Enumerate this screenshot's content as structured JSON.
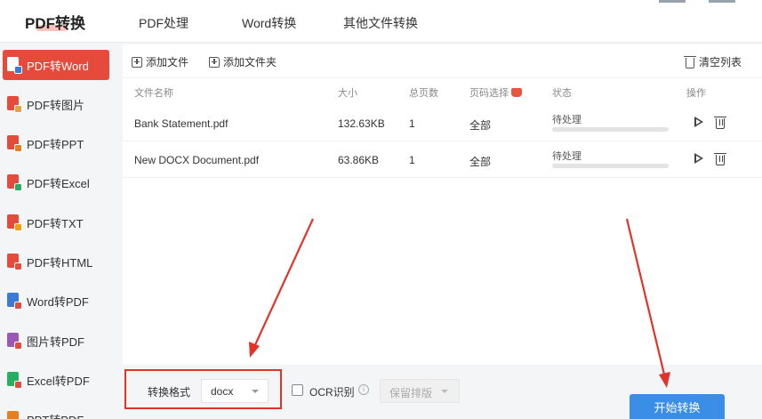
{
  "topnav": {
    "brand": "PDF转换",
    "tabs": [
      "PDF处理",
      "Word转换",
      "其他文件转换"
    ]
  },
  "sidebar": {
    "items": [
      {
        "label": "PDF转Word",
        "active": true,
        "color": "#e64a3b",
        "tag": "#3a7bd5"
      },
      {
        "label": "PDF转图片",
        "active": false,
        "color": "#e64a3b",
        "tag": "#e6a23c"
      },
      {
        "label": "PDF转PPT",
        "active": false,
        "color": "#e64a3b",
        "tag": "#e67e22"
      },
      {
        "label": "PDF转Excel",
        "active": false,
        "color": "#e64a3b",
        "tag": "#27ae60"
      },
      {
        "label": "PDF转TXT",
        "active": false,
        "color": "#e64a3b",
        "tag": "#f39c12"
      },
      {
        "label": "PDF转HTML",
        "active": false,
        "color": "#e64a3b",
        "tag": "#e74c3c"
      },
      {
        "label": "Word转PDF",
        "active": false,
        "color": "#3a7bd5",
        "tag": "#e64a3b"
      },
      {
        "label": "图片转PDF",
        "active": false,
        "color": "#9b59b6",
        "tag": "#e64a3b"
      },
      {
        "label": "Excel转PDF",
        "active": false,
        "color": "#27ae60",
        "tag": "#e64a3b"
      },
      {
        "label": "PPT转PDF",
        "active": false,
        "color": "#e67e22",
        "tag": "#e64a3b"
      }
    ]
  },
  "toolbar": {
    "add_file": "添加文件",
    "add_folder": "添加文件夹",
    "clear_list": "清空列表"
  },
  "table": {
    "columns": {
      "name": "文件名称",
      "size": "大小",
      "pages": "总页数",
      "page_select": "页码选择",
      "status": "状态",
      "actions": "操作"
    },
    "rows": [
      {
        "name": "Bank Statement.pdf",
        "size": "132.63KB",
        "pages": "1",
        "page_select": "全部",
        "status": "待处理",
        "progress": 0
      },
      {
        "name": "New DOCX Document.pdf",
        "size": "63.86KB",
        "pages": "1",
        "page_select": "全部",
        "status": "待处理",
        "progress": 0
      }
    ]
  },
  "bottom": {
    "format_label": "转换格式",
    "format_value": "docx",
    "ocr_label": "OCR识别",
    "info_glyph": "i",
    "layout_value": "保留排版",
    "start_button": "开始转换"
  },
  "colors": {
    "accent_red": "#e64a3b",
    "primary_blue": "#3a8ee6",
    "annotation_red": "#e0342a"
  }
}
